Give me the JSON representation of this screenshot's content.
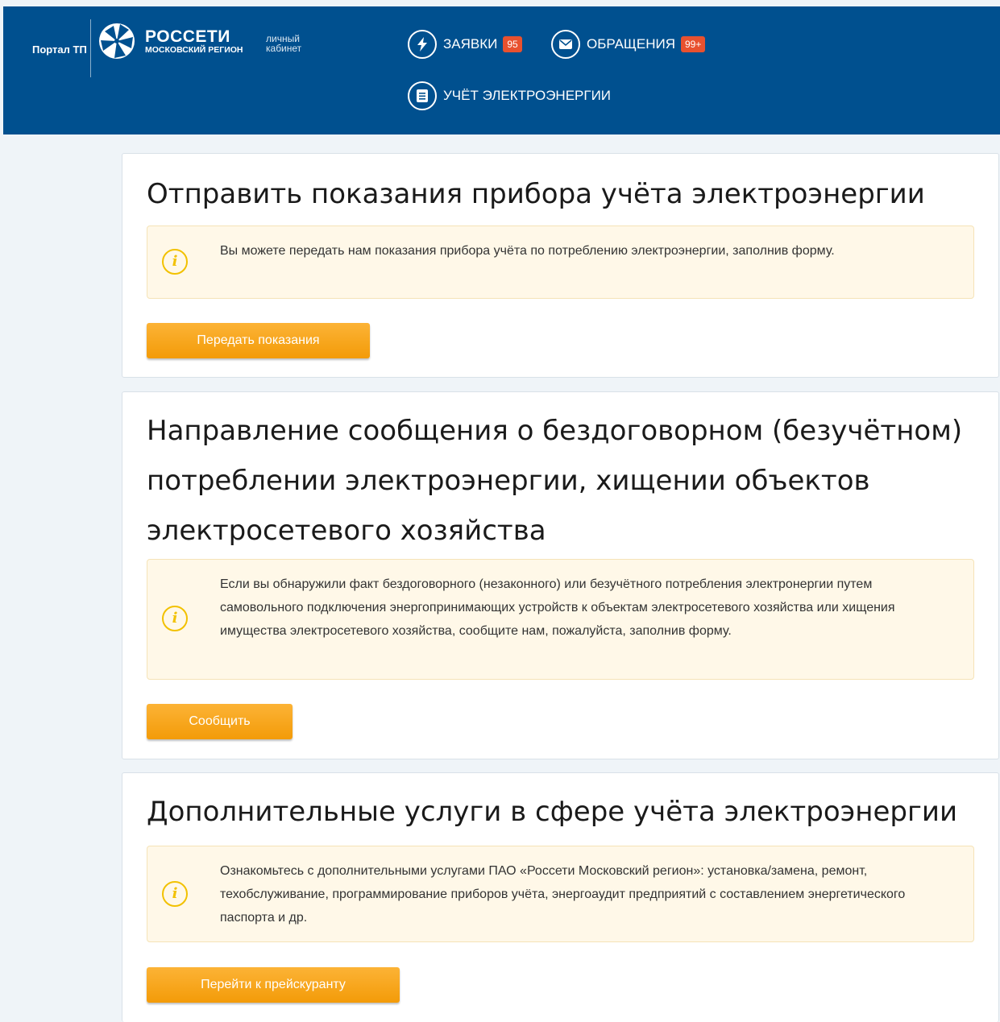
{
  "header": {
    "portal_link": "Портал ТП",
    "logo": {
      "name": "РОССЕТИ",
      "subtitle": "МОСКОВСКИЙ РЕГИОН"
    },
    "cabinet_line1": "личный",
    "cabinet_line2": "кабинет",
    "nav": {
      "requests": {
        "label": "ЗАЯВКИ",
        "badge": "95",
        "icon": "lightning-icon"
      },
      "appeals": {
        "label": "ОБРАЩЕНИЯ",
        "badge": "99+",
        "icon": "envelope-icon"
      },
      "metering": {
        "label": "УЧЁТ ЭЛЕКТРОЭНЕРГИИ",
        "icon": "document-icon"
      }
    }
  },
  "cards": [
    {
      "title": "Отправить показания прибора учёта электроэнергии",
      "note": "Вы можете передать нам показания прибора учёта по потреблению электроэнергии, заполнив форму.",
      "button": "Передать показания"
    },
    {
      "title": "Направление сообщения о бездоговорном (безучётном) потреблении электроэнергии, хищении объектов электросетевого хозяйства",
      "note": "Если вы обнаружили факт бездоговорного (незаконного) или безучётного потребления электронергии путем самовольного подключения энергопринимающих устройств к объектам электросетевого хозяйства или хищения имущества электросетевого хозяйства, сообщите нам, пожалуйста, заполнив форму.",
      "button": "Сообщить"
    },
    {
      "title": "Дополнительные услуги в сфере учёта электроэнергии",
      "note": "Ознакомьтесь с дополнительными услугами ПАО «Россети Московский регион»: установка/замена, ремонт, техобслуживание, программирование приборов учёта, энергоаудит предприятий с составлением энергетического паспорта и др.",
      "button": "Перейти к прейскуранту"
    }
  ],
  "colors": {
    "header_bg": "#00508f",
    "page_bg": "#eff4f8",
    "button": "#f7a21b",
    "badge": "#e8512f",
    "note_bg": "#fff8e8",
    "info_icon": "#f2c100"
  },
  "icons": {
    "info": "info-icon"
  }
}
